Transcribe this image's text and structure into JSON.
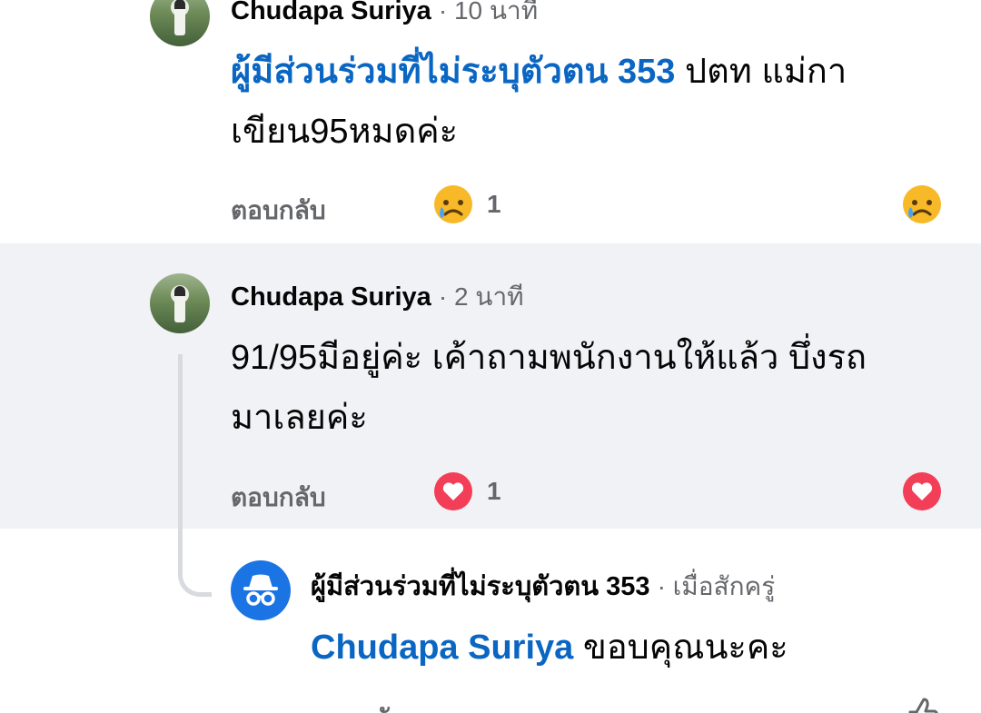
{
  "comments": [
    {
      "author": "Chudapa Suriya",
      "time": "· 10 นาที",
      "mention": "ผู้มีส่วนร่วมที่ไม่ระบุตัวตน 353",
      "text_line1": " ปตท แม่กา",
      "text_line2": "เขียน95หมดค่ะ",
      "reply_label": "ตอบกลับ",
      "reaction_icon": "sad-emoji-icon",
      "reaction_count": "1"
    },
    {
      "author": "Chudapa Suriya",
      "time": "· 2 นาที",
      "text_line1": "91/95มีอยู่ค่ะ เค้าถามพนักงานให้แล้ว บึ่งรถ",
      "text_line2": "มาเลยค่ะ",
      "reply_label": "ตอบกลับ",
      "reaction_icon": "heart-love-icon",
      "reaction_count": "1"
    },
    {
      "author": "ผู้มีส่วนร่วมที่ไม่ระบุตัวตน 353",
      "time": "· เมื่อสักครู่",
      "mention": "Chudapa Suriya",
      "text_line1": " ขอบคุณนะคะ",
      "reply_label": "ตอบกลับ",
      "reaction_icon": "like-outline-icon"
    }
  ],
  "colors": {
    "mention": "#0a66c2",
    "highlight_bg": "#f0f2f5",
    "anon_avatar": "#1b74e4",
    "heart": "#f33e58",
    "sad": "#f7b928"
  }
}
